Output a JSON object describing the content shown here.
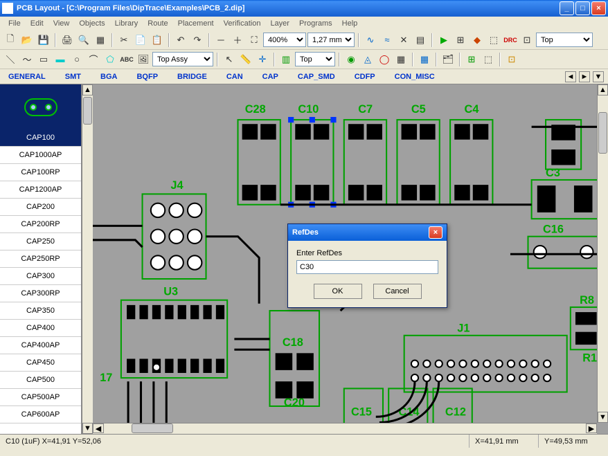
{
  "window": {
    "title": "PCB Layout - [C:\\Program Files\\DipTrace\\Examples\\PCB_2.dip]",
    "min_icon": "_",
    "max_icon": "□",
    "close_icon": "×"
  },
  "menu": [
    "File",
    "Edit",
    "View",
    "Objects",
    "Library",
    "Route",
    "Placement",
    "Verification",
    "Layer",
    "Programs",
    "Help"
  ],
  "toolbar1": {
    "zoom_value": "400%",
    "grid_value": "1,27 mm",
    "layer_value": "Top"
  },
  "toolbar2": {
    "assy_value": "Top Assy",
    "layer2_value": "Top"
  },
  "categories": [
    "GENERAL",
    "SMT",
    "BGA",
    "BQFP",
    "BRIDGE",
    "CAN",
    "CAP",
    "CAP_SMD",
    "CDFP",
    "CON_MISC"
  ],
  "componentList": {
    "selected": "CAP100",
    "items": [
      "CAP100",
      "CAP1000AP",
      "CAP100RP",
      "CAP1200AP",
      "CAP200",
      "CAP200RP",
      "CAP250",
      "CAP250RP",
      "CAP300",
      "CAP300RP",
      "CAP350",
      "CAP400",
      "CAP400AP",
      "CAP450",
      "CAP500",
      "CAP500AP",
      "CAP600AP"
    ]
  },
  "pcb_labels": {
    "c28": "C28",
    "c10": "C10",
    "c7": "C7",
    "c5": "C5",
    "c4": "C4",
    "j4": "J4",
    "u3": "U3",
    "c3": "C3",
    "c16": "C16",
    "r8": "R8",
    "c18": "C18",
    "j1": "J1",
    "r1": "R1",
    "c20": "C20",
    "c15": "C15",
    "c14": "C14",
    "c12": "C12",
    "p17": "17"
  },
  "dialog": {
    "title": "RefDes",
    "label": "Enter RefDes",
    "value": "C30",
    "ok": "OK",
    "cancel": "Cancel",
    "close_icon": "×"
  },
  "status": {
    "info": "C10 (1uF)  X=41,91  Y=52,06",
    "x": "X=41,91 mm",
    "y": "Y=49,53 mm"
  },
  "nav": {
    "left": "◄",
    "right": "►",
    "down": "▼"
  }
}
